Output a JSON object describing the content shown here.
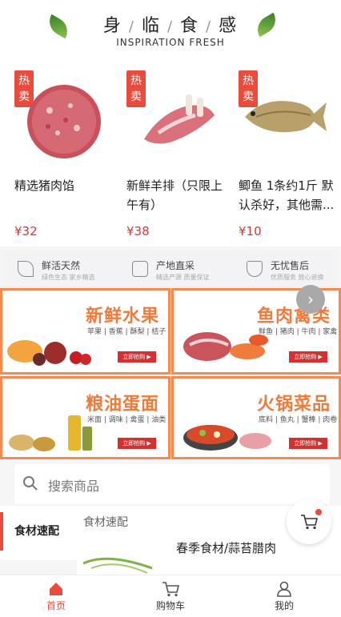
{
  "header": {
    "title_chars": [
      "身",
      "临",
      "食",
      "感"
    ],
    "title_sep": "/",
    "subtitle": "INSPIRATION FRESH"
  },
  "hot_products": [
    {
      "badge_top": "热",
      "badge_bottom": "卖",
      "name": "精选猪肉馅",
      "price": "¥32"
    },
    {
      "badge_top": "热",
      "badge_bottom": "卖",
      "name": "新鲜羊排（只限上午有）",
      "price": "¥38"
    },
    {
      "badge_top": "热",
      "badge_bottom": "卖",
      "name": "鲫鱼 1条约1斤 默认杀好，其他需...",
      "price": "¥10"
    }
  ],
  "features": [
    {
      "title": "鲜活天然",
      "sub": "绿色生态 家乡精选"
    },
    {
      "title": "产地直采",
      "sub": "精选产源 质量保证"
    },
    {
      "title": "无忧售后",
      "sub": "优质服务 放心退换"
    }
  ],
  "banners": [
    {
      "title": "新鲜水果",
      "tags": "苹果 | 香蕉 | 酥梨 | 桔子",
      "btn": "立即抢购 ▶"
    },
    {
      "title": "鱼肉禽类",
      "tags": "鲜鱼 | 猪肉 | 牛肉 | 家禽",
      "btn": "立即抢购 ▶"
    },
    {
      "title": "粮油蛋面",
      "tags": "米面 | 调味 | 禽蛋 | 油类",
      "btn": "立即抢购 ▶"
    },
    {
      "title": "火锅菜品",
      "tags": "底料 | 鱼丸 | 蟹棒 | 肉卷",
      "btn": "立即抢购 ▶"
    }
  ],
  "search": {
    "placeholder": "搜索商品"
  },
  "category": {
    "active": "食材速配",
    "section_label": "食材速配",
    "featured_title": "春季食材/蒜苔腊肉"
  },
  "tabbar": {
    "items": [
      {
        "label": "首页",
        "active": true
      },
      {
        "label": "购物车",
        "active": false
      },
      {
        "label": "我的",
        "active": false
      }
    ]
  },
  "colors": {
    "accent_red": "#e94b3c",
    "price_red": "#d6372e",
    "banner_orange": "#f07a3a"
  }
}
